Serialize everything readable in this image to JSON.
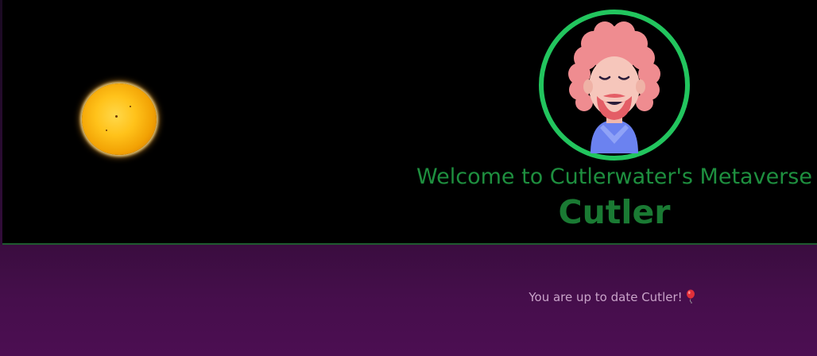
{
  "header": {
    "welcome": "Welcome to Cutlerwater's Metaverse",
    "name": "Cutler",
    "avatar_icon": "bearded-man-avatar-icon",
    "sun_icon": "sun-icon"
  },
  "footer": {
    "status": "You are up to date Cutler!",
    "status_icon": "balloon-icon"
  },
  "colors": {
    "title_green": "#1e8f3f",
    "ring_green": "#22c55e",
    "footer_purple": "#460e4c",
    "status_text": "#c9a3c9"
  }
}
